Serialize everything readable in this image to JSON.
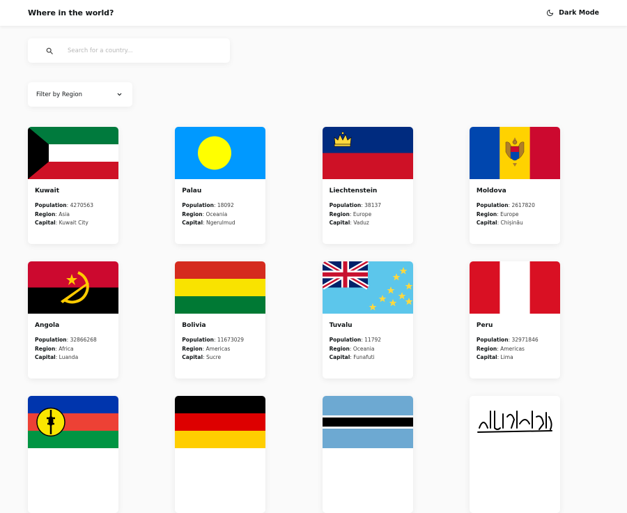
{
  "header": {
    "title": "Where in the world?",
    "mode_label": "Dark Mode"
  },
  "search": {
    "placeholder": "Search for a country..."
  },
  "filter": {
    "label": "Filter by Region"
  },
  "labels": {
    "population": "Population",
    "region": "Region",
    "capital": "Capital"
  },
  "countries": [
    {
      "name": "Kuwait",
      "population": "4270563",
      "region": "Asia",
      "capital": "Kuwait City"
    },
    {
      "name": "Palau",
      "population": "18092",
      "region": "Oceania",
      "capital": "Ngerulmud"
    },
    {
      "name": "Liechtenstein",
      "population": "38137",
      "region": "Europe",
      "capital": "Vaduz"
    },
    {
      "name": "Moldova",
      "population": "2617820",
      "region": "Europe",
      "capital": "Chișinău"
    },
    {
      "name": "Angola",
      "population": "32866268",
      "region": "Africa",
      "capital": "Luanda"
    },
    {
      "name": "Bolivia",
      "population": "11673029",
      "region": "Americas",
      "capital": "Sucre"
    },
    {
      "name": "Tuvalu",
      "population": "11792",
      "region": "Oceania",
      "capital": "Funafuti"
    },
    {
      "name": "Peru",
      "population": "32971846",
      "region": "Americas",
      "capital": "Lima"
    }
  ],
  "partial_flags": [
    "new-caledonia-flag",
    "germany-flag",
    "botswana-flag",
    "afghanistan-flag"
  ]
}
